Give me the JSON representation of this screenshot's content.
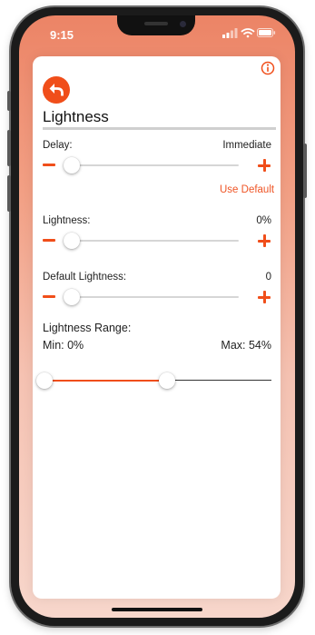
{
  "status_bar": {
    "time": "9:15",
    "signal_icon": "signal-icon",
    "wifi_icon": "wifi-icon",
    "battery_icon": "battery-icon"
  },
  "header": {
    "title": "Lightness",
    "back_icon": "undo-arrow-icon",
    "info_icon": "info-icon"
  },
  "delay": {
    "label": "Delay:",
    "value": "Immediate",
    "slider_fraction": 0.0,
    "use_default_label": "Use Default"
  },
  "lightness": {
    "label": "Lightness:",
    "value": "0%",
    "slider_fraction": 0.0
  },
  "default_lightness": {
    "label": "Default Lightness:",
    "value": "0",
    "slider_fraction": 0.0
  },
  "lightness_range": {
    "label": "Lightness Range:",
    "min_label": "Min: 0%",
    "max_label": "Max: 54%",
    "min_percent": 0,
    "max_percent": 54
  },
  "colors": {
    "accent": "#f04e1a",
    "link": "#ef5526",
    "track": "#d6d6d6",
    "background_gradient_top": "#ec8466"
  }
}
